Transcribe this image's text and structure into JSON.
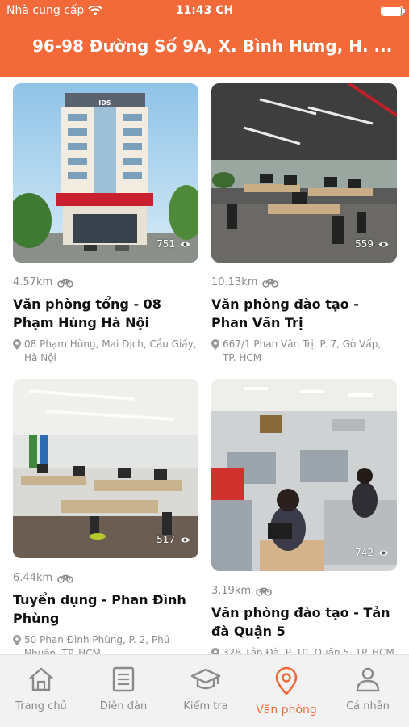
{
  "status_bar": {
    "carrier": "Nhà cung cấp",
    "time": "11:43 CH",
    "battery_percent": 100
  },
  "header": {
    "address": "96-98 Đường Số 9A, X. Bình Hưng, H. ..."
  },
  "offices": [
    {
      "views": "751",
      "distance": "4.57km",
      "title": "Văn phòng tổng - 08 Phạm Hùng Hà Nội",
      "address": "08 Phạm Hùng, Mai Dịch, Cầu Giấy, Hà Nội",
      "image_label": "IDS"
    },
    {
      "views": "559",
      "distance": "10.13km",
      "title": "Văn phòng đào tạo - Phan Văn Trị",
      "address": "667/1 Phan Văn Trị, P. 7, Gò Vấp, TP. HCM"
    },
    {
      "views": "517",
      "distance": "6.44km",
      "title": "Tuyển dụng - Phan Đình Phùng",
      "address": "50 Phan Đình Phùng, P. 2, Phú Nhuận, TP. HCM"
    },
    {
      "views": "742",
      "distance": "3.19km",
      "title": "Văn phòng đào tạo - Tản đà Quận 5",
      "address": "32B Tản Đà, P. 10, Quận 5, TP. HCM"
    }
  ],
  "tabs": [
    {
      "label": "Trang chủ",
      "icon": "home-icon"
    },
    {
      "label": "Diễn đàn",
      "icon": "forum-icon"
    },
    {
      "label": "Kiểm tra",
      "icon": "graduation-cap-icon"
    },
    {
      "label": "Văn phòng",
      "icon": "location-pin-icon"
    },
    {
      "label": "Cá nhân",
      "icon": "person-icon"
    }
  ],
  "active_tab": "Văn phòng",
  "colors": {
    "accent": "#f26a3a",
    "tab_inactive": "#8a8a8a",
    "tabbar_bg": "#f2f2f2"
  }
}
